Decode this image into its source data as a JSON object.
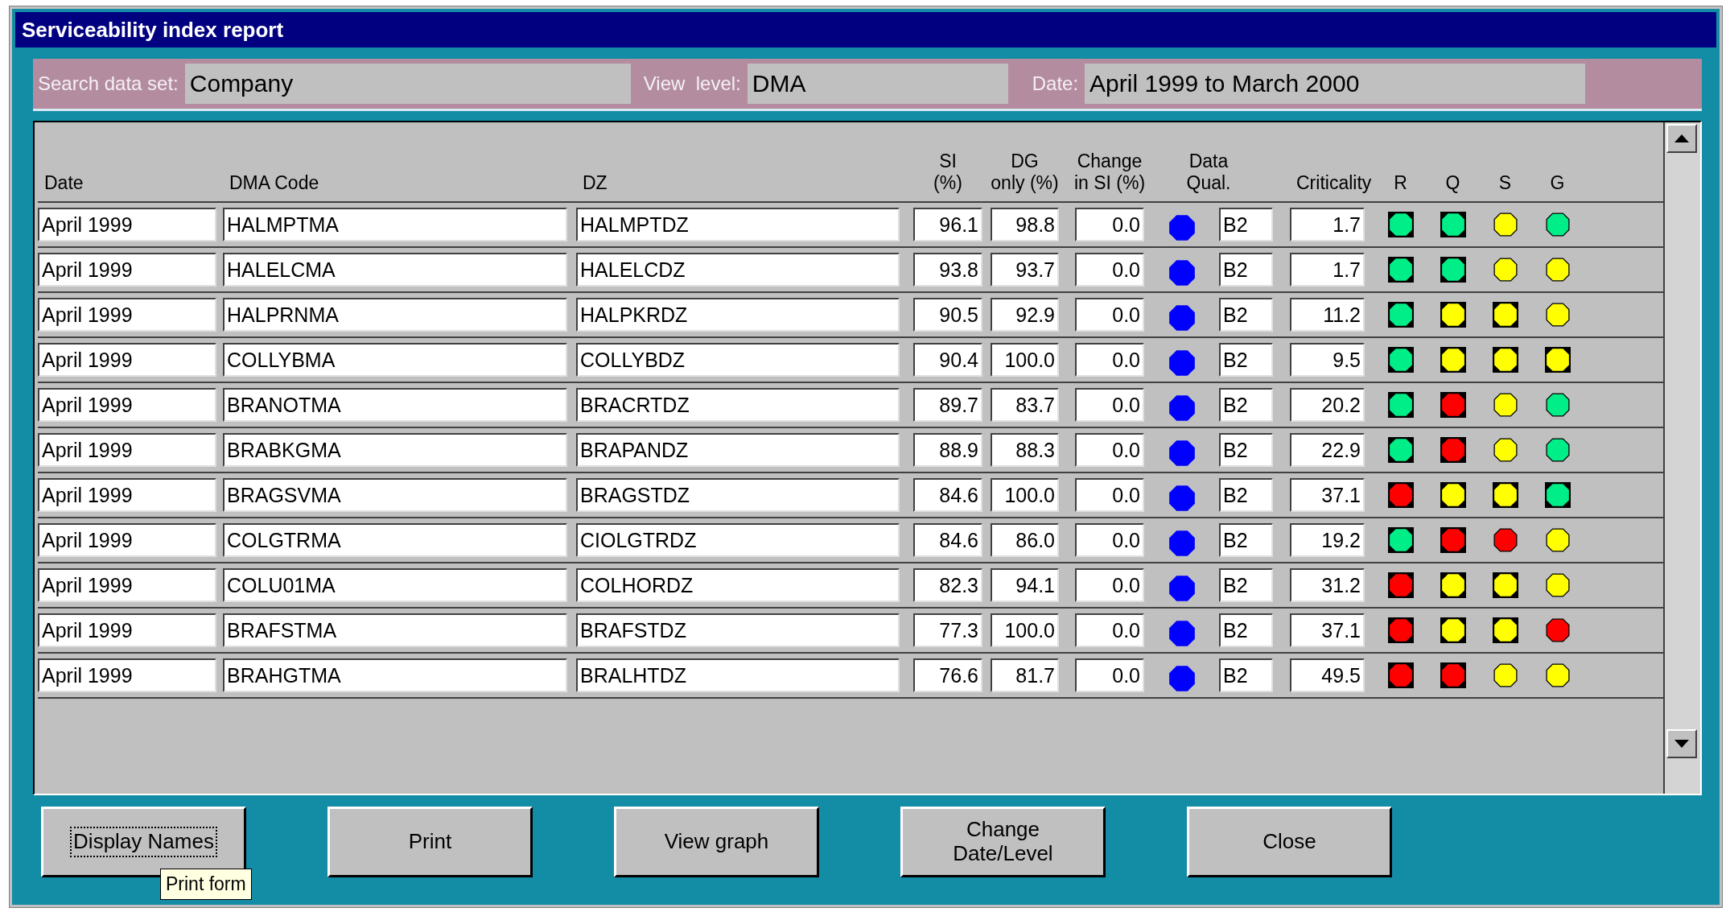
{
  "window": {
    "title": "Serviceability index report"
  },
  "filters": [
    {
      "label": "Search data set:",
      "value": "Company"
    },
    {
      "label": "View  level:",
      "value": "DMA"
    },
    {
      "label": "Date:",
      "value": "April 1999 to March 2000"
    }
  ],
  "table": {
    "columns": [
      {
        "kind": "date",
        "label": "Date"
      },
      {
        "kind": "dma",
        "label": "DMA Code"
      },
      {
        "kind": "dz",
        "label": "DZ"
      },
      {
        "kind": "si",
        "label": "SI\n(%)"
      },
      {
        "kind": "dg",
        "label": "DG\nonly (%)"
      },
      {
        "kind": "change",
        "label": "Change\nin SI (%)"
      },
      {
        "kind": "qual",
        "label": "Data\nQual."
      },
      {
        "kind": "crit",
        "label": "Criticality"
      },
      {
        "kind": "r",
        "label": "R"
      },
      {
        "kind": "q",
        "label": "Q"
      },
      {
        "kind": "s",
        "label": "S"
      },
      {
        "kind": "g",
        "label": "G"
      }
    ],
    "rows": [
      {
        "date": "April 1999",
        "dma_code": "HALMPTMA",
        "dz": "HALMPTDZ",
        "si": "96.1",
        "dg_only": "98.8",
        "change_si": "0.0",
        "status": {
          "color": "#0000ff"
        },
        "data_qual": "B2",
        "criticality": "1.7",
        "indicators": [
          {
            "kind": "boxed",
            "color": "#00ee88"
          },
          {
            "kind": "boxed",
            "color": "#00ee88"
          },
          {
            "kind": "plain",
            "color": "#ffff00"
          },
          {
            "kind": "plain",
            "color": "#00ee88"
          }
        ]
      },
      {
        "date": "April 1999",
        "dma_code": "HALELCMA",
        "dz": "HALELCDZ",
        "si": "93.8",
        "dg_only": "93.7",
        "change_si": "0.0",
        "status": {
          "color": "#0000ff"
        },
        "data_qual": "B2",
        "criticality": "1.7",
        "indicators": [
          {
            "kind": "boxed",
            "color": "#00ee88"
          },
          {
            "kind": "boxed",
            "color": "#00ee88"
          },
          {
            "kind": "plain",
            "color": "#ffff00"
          },
          {
            "kind": "plain",
            "color": "#ffff00"
          }
        ]
      },
      {
        "date": "April 1999",
        "dma_code": "HALPRNMA",
        "dz": "HALPKRDZ",
        "si": "90.5",
        "dg_only": "92.9",
        "change_si": "0.0",
        "status": {
          "color": "#0000ff"
        },
        "data_qual": "B2",
        "criticality": "11.2",
        "indicators": [
          {
            "kind": "boxed",
            "color": "#00ee88"
          },
          {
            "kind": "boxed",
            "color": "#ffff00"
          },
          {
            "kind": "boxed",
            "color": "#ffff00"
          },
          {
            "kind": "plain",
            "color": "#ffff00"
          }
        ]
      },
      {
        "date": "April 1999",
        "dma_code": "COLLYBMA",
        "dz": "COLLYBDZ",
        "si": "90.4",
        "dg_only": "100.0",
        "change_si": "0.0",
        "status": {
          "color": "#0000ff"
        },
        "data_qual": "B2",
        "criticality": "9.5",
        "indicators": [
          {
            "kind": "boxed",
            "color": "#00ee88"
          },
          {
            "kind": "boxed",
            "color": "#ffff00"
          },
          {
            "kind": "boxed",
            "color": "#ffff00"
          },
          {
            "kind": "boxed",
            "color": "#ffff00"
          }
        ]
      },
      {
        "date": "April 1999",
        "dma_code": "BRANOTMA",
        "dz": "BRACRTDZ",
        "si": "89.7",
        "dg_only": "83.7",
        "change_si": "0.0",
        "status": {
          "color": "#0000ff"
        },
        "data_qual": "B2",
        "criticality": "20.2",
        "indicators": [
          {
            "kind": "boxed",
            "color": "#00ee88"
          },
          {
            "kind": "boxed",
            "color": "#ff0000"
          },
          {
            "kind": "plain",
            "color": "#ffff00"
          },
          {
            "kind": "plain",
            "color": "#00ee88"
          }
        ]
      },
      {
        "date": "April 1999",
        "dma_code": "BRABKGMA",
        "dz": "BRAPANDZ",
        "si": "88.9",
        "dg_only": "88.3",
        "change_si": "0.0",
        "status": {
          "color": "#0000ff"
        },
        "data_qual": "B2",
        "criticality": "22.9",
        "indicators": [
          {
            "kind": "boxed",
            "color": "#00ee88"
          },
          {
            "kind": "boxed",
            "color": "#ff0000"
          },
          {
            "kind": "plain",
            "color": "#ffff00"
          },
          {
            "kind": "plain",
            "color": "#00ee88"
          }
        ]
      },
      {
        "date": "April 1999",
        "dma_code": "BRAGSVMA",
        "dz": "BRAGSTDZ",
        "si": "84.6",
        "dg_only": "100.0",
        "change_si": "0.0",
        "status": {
          "color": "#0000ff"
        },
        "data_qual": "B2",
        "criticality": "37.1",
        "indicators": [
          {
            "kind": "boxed",
            "color": "#ff0000"
          },
          {
            "kind": "boxed",
            "color": "#ffff00"
          },
          {
            "kind": "boxed",
            "color": "#ffff00"
          },
          {
            "kind": "boxed",
            "color": "#00ee88"
          }
        ]
      },
      {
        "date": "April 1999",
        "dma_code": "COLGTRMA",
        "dz": "CIOLGTRDZ",
        "si": "84.6",
        "dg_only": "86.0",
        "change_si": "0.0",
        "status": {
          "color": "#0000ff"
        },
        "data_qual": "B2",
        "criticality": "19.2",
        "indicators": [
          {
            "kind": "boxed",
            "color": "#00ee88"
          },
          {
            "kind": "boxed",
            "color": "#ff0000"
          },
          {
            "kind": "plain",
            "color": "#ff0000"
          },
          {
            "kind": "plain",
            "color": "#ffff00"
          }
        ]
      },
      {
        "date": "April 1999",
        "dma_code": "COLU01MA",
        "dz": "COLHORDZ",
        "si": "82.3",
        "dg_only": "94.1",
        "change_si": "0.0",
        "status": {
          "color": "#0000ff"
        },
        "data_qual": "B2",
        "criticality": "31.2",
        "indicators": [
          {
            "kind": "boxed",
            "color": "#ff0000"
          },
          {
            "kind": "boxed",
            "color": "#ffff00"
          },
          {
            "kind": "boxed",
            "color": "#ffff00"
          },
          {
            "kind": "plain",
            "color": "#ffff00"
          }
        ]
      },
      {
        "date": "April 1999",
        "dma_code": "BRAFSTMA",
        "dz": "BRAFSTDZ",
        "si": "77.3",
        "dg_only": "100.0",
        "change_si": "0.0",
        "status": {
          "color": "#0000ff"
        },
        "data_qual": "B2",
        "criticality": "37.1",
        "indicators": [
          {
            "kind": "boxed",
            "color": "#ff0000"
          },
          {
            "kind": "boxed",
            "color": "#ffff00"
          },
          {
            "kind": "boxed",
            "color": "#ffff00"
          },
          {
            "kind": "plain",
            "color": "#ff0000"
          }
        ]
      },
      {
        "date": "April 1999",
        "dma_code": "BRAHGTMA",
        "dz": "BRALHTDZ",
        "si": "76.6",
        "dg_only": "81.7",
        "change_si": "0.0",
        "status": {
          "color": "#0000ff"
        },
        "data_qual": "B2",
        "criticality": "49.5",
        "indicators": [
          {
            "kind": "boxed",
            "color": "#ff0000"
          },
          {
            "kind": "boxed",
            "color": "#ff0000"
          },
          {
            "kind": "plain",
            "color": "#ffff00"
          },
          {
            "kind": "plain",
            "color": "#ffff00"
          }
        ]
      }
    ]
  },
  "buttons": [
    {
      "label": "Display Names",
      "focused": true
    },
    {
      "label": "Print",
      "focused": false
    },
    {
      "label": "View graph",
      "focused": false
    },
    {
      "label": "Change\nDate/Level",
      "focused": false
    },
    {
      "label": "Close",
      "focused": false
    }
  ],
  "tooltip": {
    "text": "Print form"
  }
}
